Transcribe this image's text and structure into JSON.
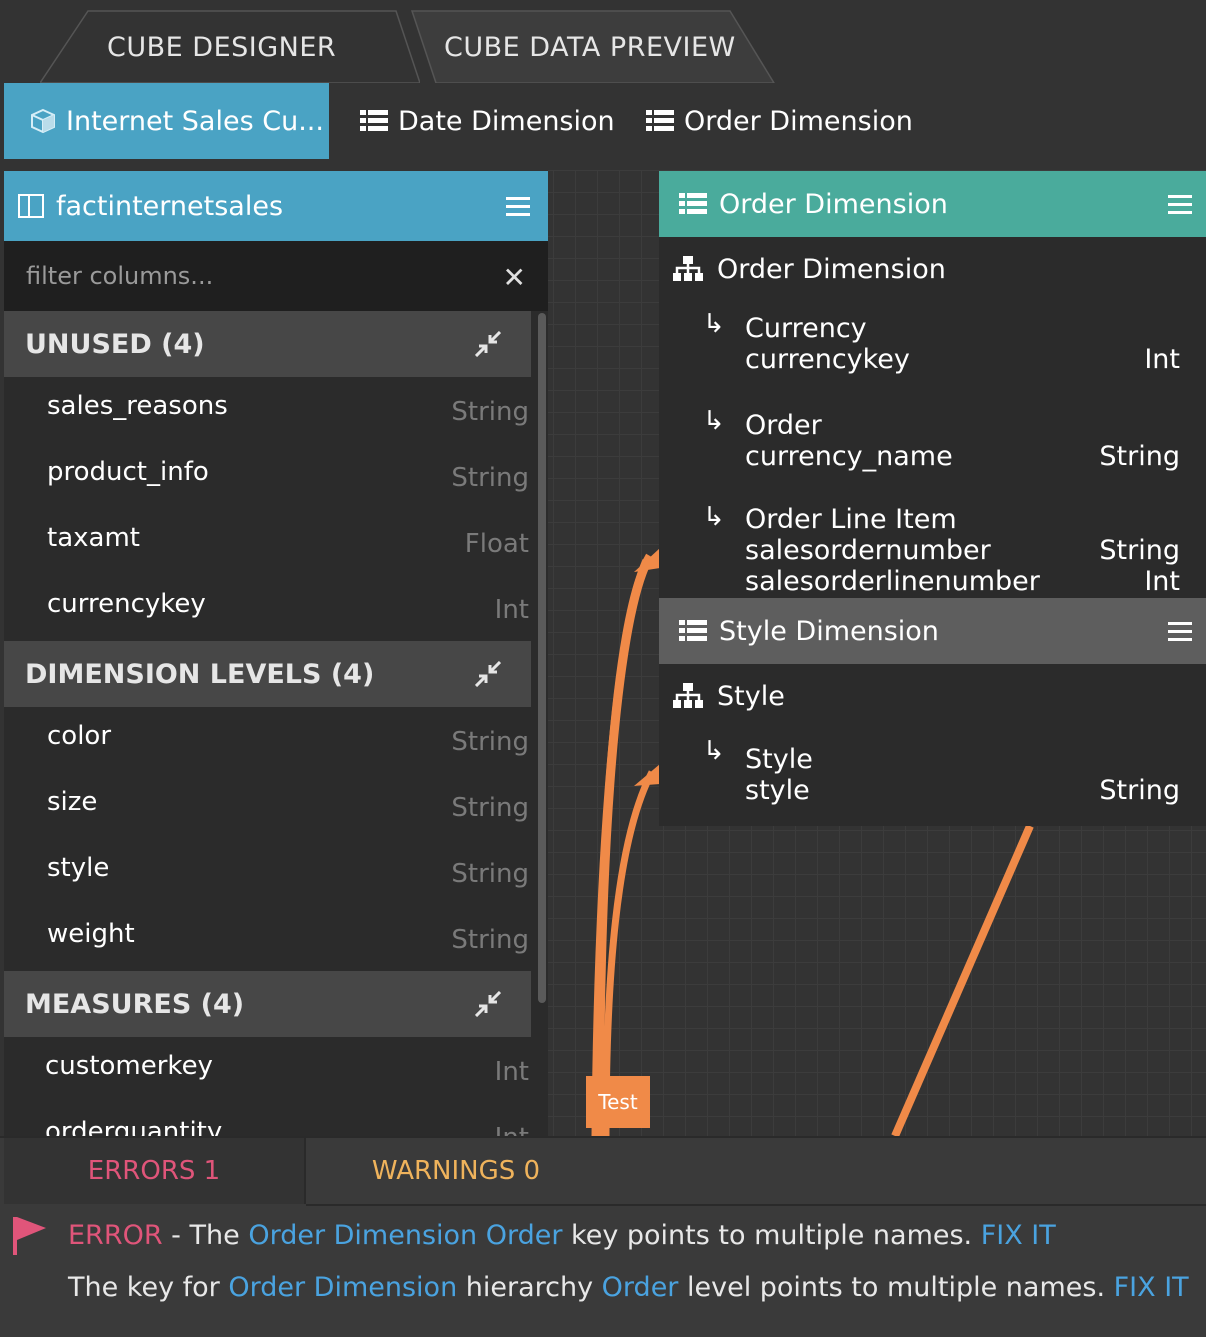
{
  "top_tabs": [
    {
      "label": "CUBE DESIGNER"
    },
    {
      "label": "CUBE DATA PREVIEW"
    }
  ],
  "sub_tabs": [
    {
      "label": "Internet Sales Cu...",
      "icon": "cube-icon",
      "active": true
    },
    {
      "label": "Date Dimension",
      "icon": "list-icon"
    },
    {
      "label": "Order Dimension",
      "icon": "list-icon"
    }
  ],
  "fact_table": {
    "title": "factinternetsales",
    "filter_placeholder": "filter columns...",
    "groups": [
      {
        "title": "UNUSED (4)",
        "columns": [
          {
            "name": "sales_reasons",
            "type": "String"
          },
          {
            "name": "product_info",
            "type": "String"
          },
          {
            "name": "taxamt",
            "type": "Float"
          },
          {
            "name": "currencykey",
            "type": "Int"
          }
        ]
      },
      {
        "title": "DIMENSION LEVELS (4)",
        "columns": [
          {
            "name": "color",
            "type": "String"
          },
          {
            "name": "size",
            "type": "String"
          },
          {
            "name": "style",
            "type": "String"
          },
          {
            "name": "weight",
            "type": "String"
          }
        ]
      },
      {
        "title": "MEASURES (4)",
        "columns": [
          {
            "name": "customerkey",
            "type": "Int"
          },
          {
            "name": "orderquantity",
            "type": "Int"
          }
        ]
      }
    ]
  },
  "order_dimension": {
    "title": "Order Dimension",
    "hierarchy": "Order Dimension",
    "levels": [
      {
        "label": "Currency",
        "columns": [
          {
            "name": "currencykey",
            "type": "Int"
          }
        ]
      },
      {
        "label": "Order",
        "columns": [
          {
            "name": "currency_name",
            "type": "String"
          }
        ]
      },
      {
        "label": "Order Line Item",
        "columns": [
          {
            "name": "salesordernumber",
            "type": "String"
          },
          {
            "name": "salesorderlinenumber",
            "type": "Int"
          }
        ]
      }
    ]
  },
  "style_dimension": {
    "title": "Style Dimension",
    "hierarchy": "Style",
    "levels": [
      {
        "label": "Style",
        "columns": [
          {
            "name": "style",
            "type": "String"
          }
        ]
      }
    ]
  },
  "edge_label": "Test",
  "bottom": {
    "errors_tab": "ERRORS 1",
    "warnings_tab": "WARNINGS 0",
    "error_line": {
      "prefix": "ERROR",
      "t1": " - The ",
      "link1": "Order Dimension Order",
      "t2": " key points to multiple names. ",
      "fix": "FIX IT"
    },
    "detail_line": {
      "t1": "The key for ",
      "link1": "Order Dimension",
      "t2": " hierarchy ",
      "link2": "Order",
      "t3": " level points to multiple names. ",
      "fix": "FIX IT"
    }
  },
  "colors": {
    "accent_blue": "#4aa3c4",
    "accent_teal": "#4aab9c",
    "edge_orange": "#f08a48",
    "error_pink": "#e0557a",
    "warning_amber": "#efb35c",
    "link_blue": "#4aa3e0"
  }
}
